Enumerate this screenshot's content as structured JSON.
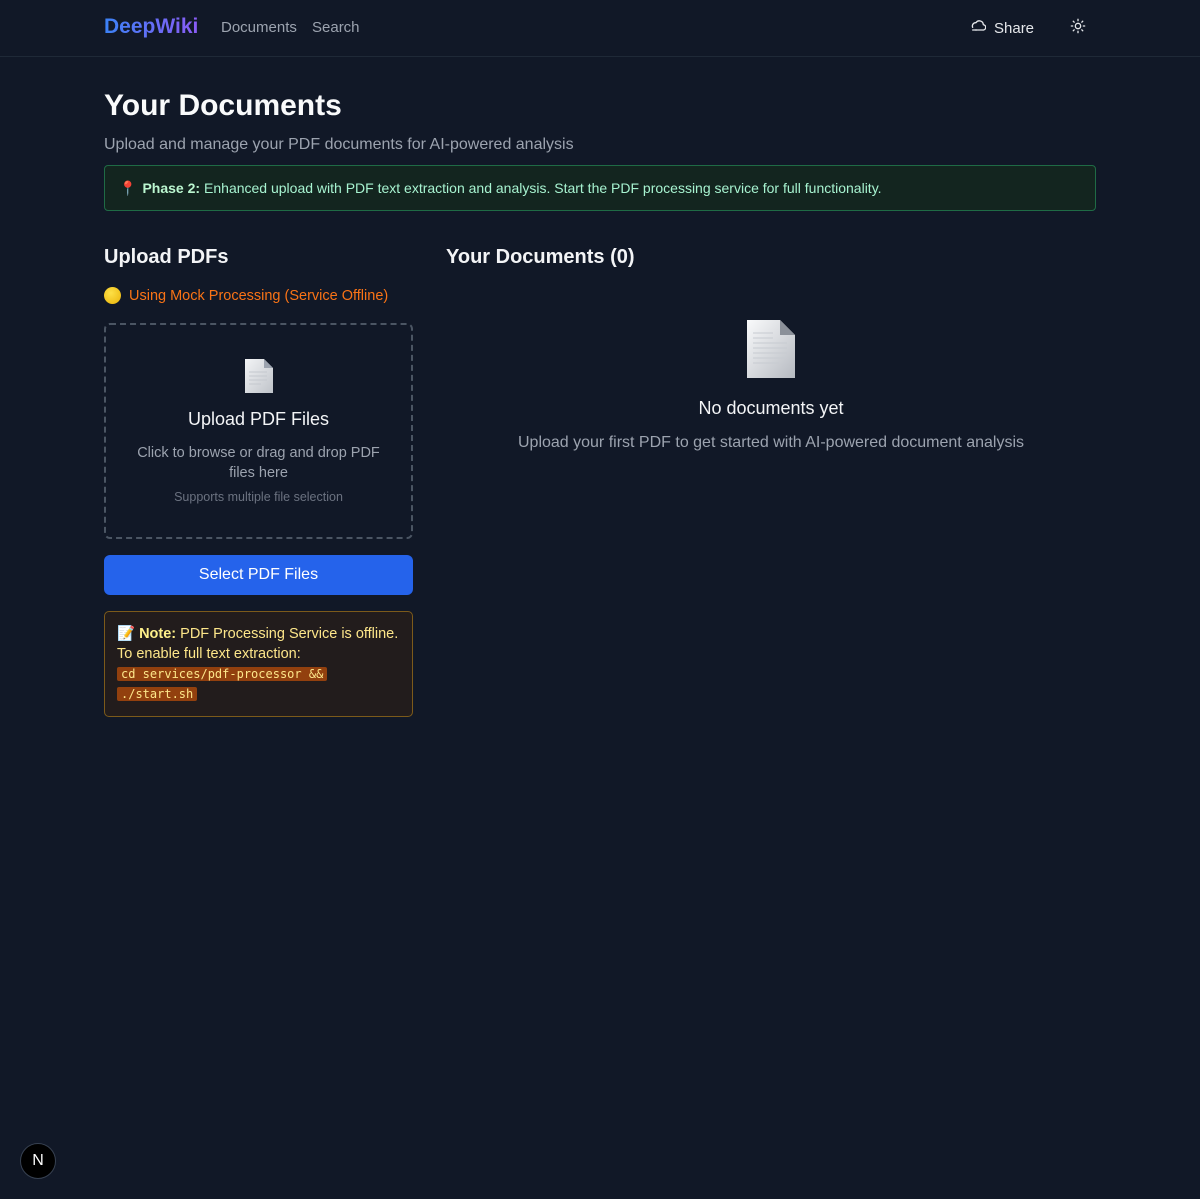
{
  "header": {
    "brand": "DeepWiki",
    "nav": [
      "Documents",
      "Search"
    ],
    "share_label": "Share",
    "share_icon": "cloud-share-icon",
    "theme_icon": "sun-icon"
  },
  "page": {
    "title": "Your Documents",
    "subtitle": "Upload and manage your PDF documents for AI-powered analysis"
  },
  "banner": {
    "icon": "📍",
    "label": "Phase 2:",
    "text": "Enhanced upload with PDF text extraction and analysis. Start the PDF processing service for full functionality."
  },
  "upload": {
    "heading": "Upload PDFs",
    "status": "Using Mock Processing (Service Offline)",
    "status_color": "#f97316",
    "dropzone": {
      "title": "Upload PDF Files",
      "description": "Click to browse or drag and drop PDF files here",
      "hint": "Supports multiple file selection"
    },
    "button_label": "Select PDF Files",
    "note": {
      "icon": "📝",
      "label": "Note:",
      "text": "PDF Processing Service is offline. To enable full text extraction:",
      "code_line1": "cd services/pdf-processor &&",
      "code_line2": "./start.sh"
    }
  },
  "documents": {
    "heading": "Your Documents (0)",
    "empty_title": "No documents yet",
    "empty_description": "Upload your first PDF to get started with AI-powered document analysis"
  },
  "dev_badge": "N",
  "colors": {
    "background": "#111827",
    "accent": "#2563eb",
    "success_border": "#1f6b45",
    "warning_border": "#7c5a1a"
  }
}
